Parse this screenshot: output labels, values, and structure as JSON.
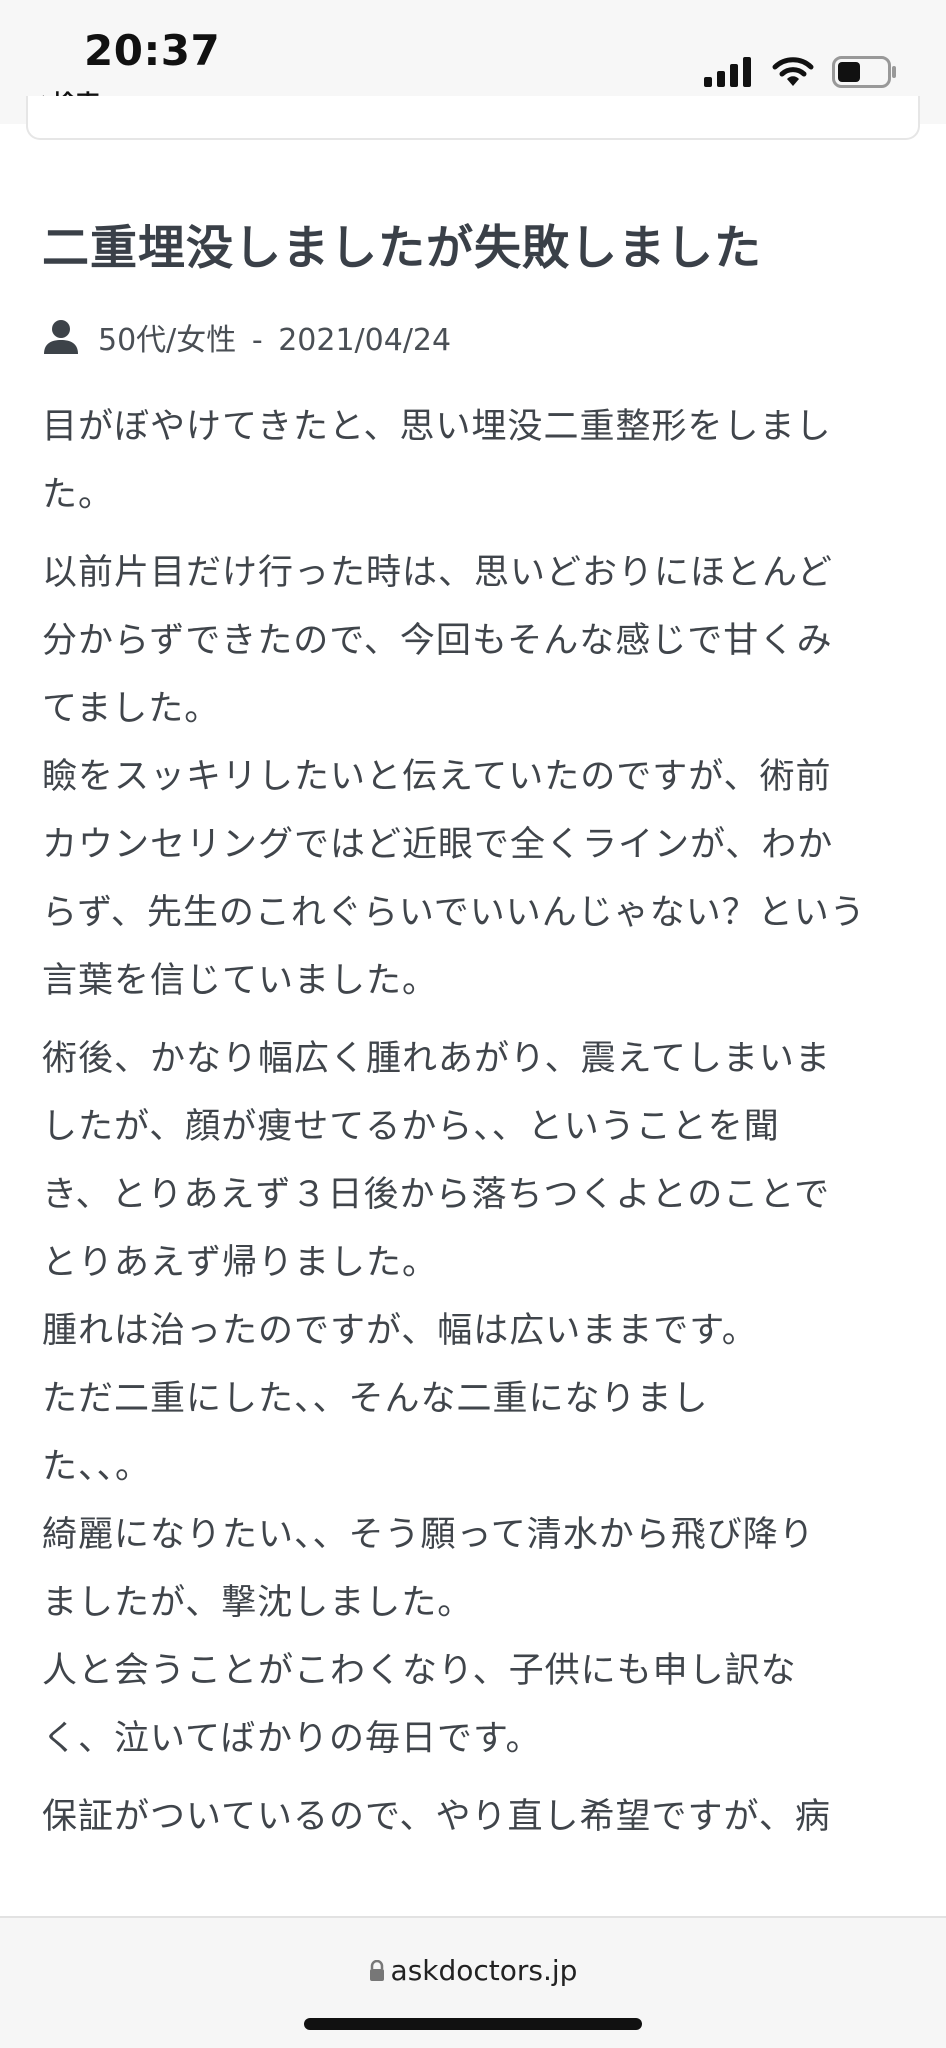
{
  "status_bar": {
    "time": "20:37",
    "back_label": "検索"
  },
  "article": {
    "title": "二重埋没しましたが失敗しました",
    "author": "50代/女性",
    "date": "2021/04/24",
    "paragraphs": [
      [
        "目がぼやけてきたと、思い埋没二重整形をしまし",
        "た。"
      ],
      [
        "以前片目だけ行った時は、思いどおりにほとんど",
        "分からずできたので、今回もそんな感じで甘くみ",
        "てました。",
        "瞼をスッキリしたいと伝えていたのですが、術前",
        "カウンセリングではど近眼で全くラインが、わか",
        "らず、先生のこれぐらいでいいんじゃない？という",
        "言葉を信じていました。"
      ],
      [
        "術後、かなり幅広く腫れあがり、震えてしまいま",
        "したが、顔が痩せてるから、、ということを聞",
        "き、とりあえず３日後から落ちつくよとのことで",
        "とりあえず帰りました。",
        "腫れは治ったのですが、幅は広いままです。",
        "ただ二重にした、、そんな二重になりまし",
        "た、、。",
        "綺麗になりたい、、そう願って清水から飛び降り",
        "ましたが、撃沈しました。",
        "人と会うことがこわくなり、子供にも申し訳な",
        "く、泣いてばかりの毎日です。"
      ],
      [
        "保証がついているので、やり直し希望ですが、病"
      ]
    ]
  },
  "browser": {
    "url": "askdoctors.jp"
  }
}
